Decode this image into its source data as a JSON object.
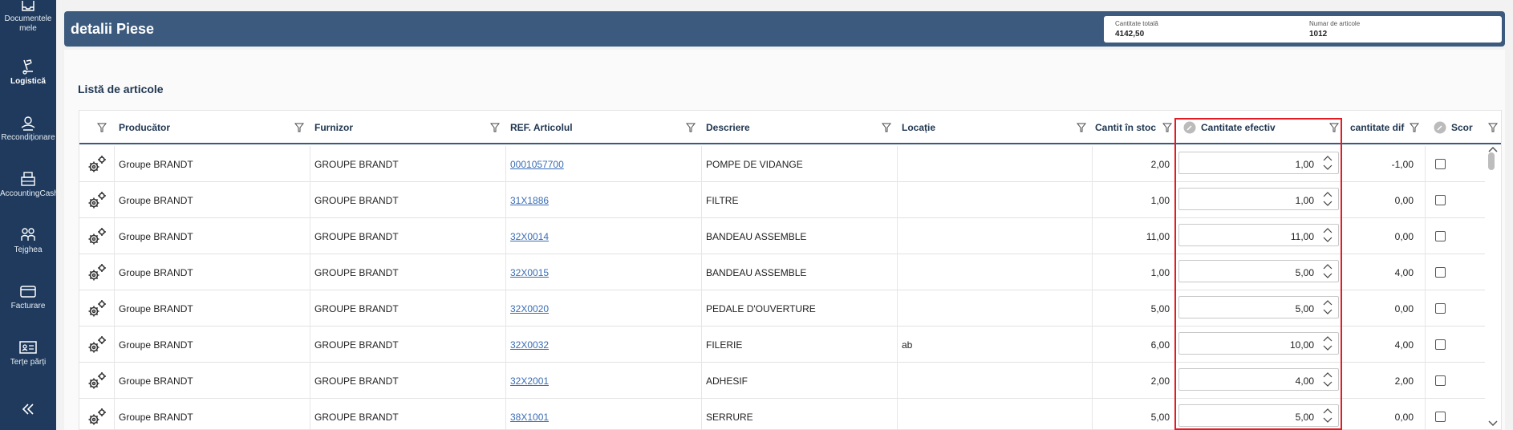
{
  "sidebar": {
    "items": [
      {
        "label": "Documentele mele",
        "icon": "inbox-icon"
      },
      {
        "label": "Logistică",
        "icon": "logistics-icon"
      },
      {
        "label": "Recondiționare",
        "icon": "refurbish-icon"
      },
      {
        "label": "AccountingCash",
        "icon": "cash-register-icon"
      },
      {
        "label": "Tejghea",
        "icon": "counter-people-icon"
      },
      {
        "label": "Facturare",
        "icon": "card-icon"
      },
      {
        "label": "Terțe părți",
        "icon": "id-card-icon"
      }
    ],
    "collapse_icon": "double-chevron-left-icon"
  },
  "header": {
    "title": "detalii Piese",
    "stats": {
      "total_qty_label": "Cantitate totală",
      "total_qty_value": "4142,50",
      "items_count_label": "Numar de articole",
      "items_count_value": "1012"
    }
  },
  "list": {
    "title": "Listă de articole",
    "columns": {
      "producer": "Producător",
      "supplier": "Furnizor",
      "ref": "REF. Articolul",
      "description": "Descriere",
      "location": "Locație",
      "stock_qty": "Cantit în stoc",
      "actual_qty": "Cantitate efectiv",
      "diff_qty": "cantitate dif",
      "score": "Scor"
    },
    "rows": [
      {
        "producer": "Groupe BRANDT",
        "supplier": "GROUPE BRANDT",
        "ref": "0001057700",
        "description": "POMPE DE VIDANGE",
        "location": "",
        "stock": "2,00",
        "actual": "1,00",
        "diff": "-1,00"
      },
      {
        "producer": "Groupe BRANDT",
        "supplier": "GROUPE BRANDT",
        "ref": "31X1886",
        "description": "FILTRE",
        "location": "",
        "stock": "1,00",
        "actual": "1,00",
        "diff": "0,00"
      },
      {
        "producer": "Groupe BRANDT",
        "supplier": "GROUPE BRANDT",
        "ref": "32X0014",
        "description": "BANDEAU ASSEMBLE",
        "location": "",
        "stock": "11,00",
        "actual": "11,00",
        "diff": "0,00"
      },
      {
        "producer": "Groupe BRANDT",
        "supplier": "GROUPE BRANDT",
        "ref": "32X0015",
        "description": "BANDEAU ASSEMBLE",
        "location": "",
        "stock": "1,00",
        "actual": "5,00",
        "diff": "4,00"
      },
      {
        "producer": "Groupe BRANDT",
        "supplier": "GROUPE BRANDT",
        "ref": "32X0020",
        "description": "PEDALE D'OUVERTURE",
        "location": "",
        "stock": "5,00",
        "actual": "5,00",
        "diff": "0,00"
      },
      {
        "producer": "Groupe BRANDT",
        "supplier": "GROUPE BRANDT",
        "ref": "32X0032",
        "description": "FILERIE",
        "location": "ab",
        "stock": "6,00",
        "actual": "10,00",
        "diff": "4,00"
      },
      {
        "producer": "Groupe BRANDT",
        "supplier": "GROUPE BRANDT",
        "ref": "32X2001",
        "description": "ADHESIF",
        "location": "",
        "stock": "2,00",
        "actual": "4,00",
        "diff": "2,00"
      },
      {
        "producer": "Groupe BRANDT",
        "supplier": "GROUPE BRANDT",
        "ref": "38X1001",
        "description": "SERRURE",
        "location": "",
        "stock": "5,00",
        "actual": "5,00",
        "diff": "0,00"
      }
    ]
  },
  "colors": {
    "sidebar_bg": "#1f3a5c",
    "header_bg": "#3c5a7d",
    "highlight_box": "#e11c24",
    "link": "#3a6db5"
  }
}
